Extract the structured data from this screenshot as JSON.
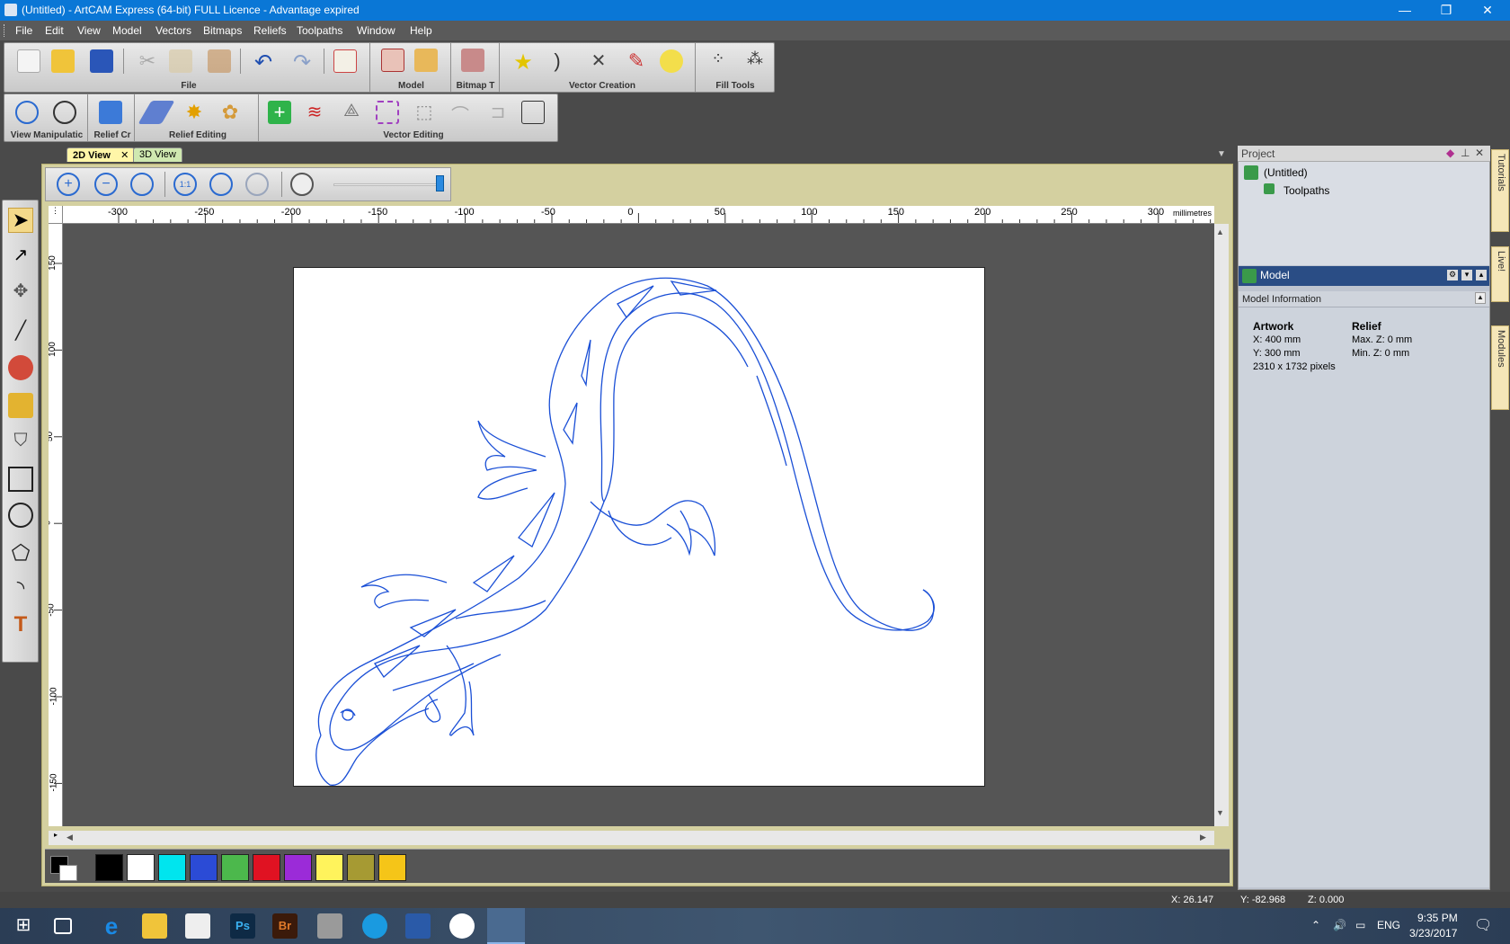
{
  "window": {
    "title": "(Untitled) - ArtCAM Express (64-bit) FULL Licence - Advantage expired",
    "minimize": "—",
    "restore": "❐",
    "close": "✕"
  },
  "menu": [
    "File",
    "Edit",
    "View",
    "Model",
    "Vectors",
    "Bitmaps",
    "Reliefs",
    "Toolpaths",
    "Window",
    "Help"
  ],
  "toolbars": {
    "file_label": "File",
    "model_label": "Model",
    "bitmap_label": "Bitmap T",
    "vector_creation_label": "Vector Creation",
    "fill_tools_label": "Fill Tools",
    "view_manipulation_label": "View Manipulatic",
    "relief_cr_label": "Relief Cr",
    "relief_editing_label": "Relief Editing",
    "vector_editing_label": "Vector Editing"
  },
  "tabs": [
    {
      "label": "2D View",
      "active": true,
      "close": "✕"
    },
    {
      "label": "3D View",
      "active": false
    }
  ],
  "ruler": {
    "h_ticks": [
      "-300",
      "-250",
      "-200",
      "-150",
      "-100",
      "-50",
      "0",
      "50",
      "100",
      "150",
      "200",
      "250",
      "300"
    ],
    "unit": "millimetres",
    "v_ticks": [
      "150",
      "100",
      "50",
      "0",
      "-50",
      "-100",
      "-150"
    ]
  },
  "palette": {
    "colors": [
      "#000000",
      "#ffffff",
      "#00e5ee",
      "#2b4bd6",
      "#4cb84c",
      "#e01222",
      "#9b2bd8",
      "#fff35c",
      "#a69a33",
      "#f5c518"
    ]
  },
  "project": {
    "title": "Project",
    "root": "(Untitled)",
    "child": "Toolpaths"
  },
  "model": {
    "title": "Model",
    "info_title": "Model Information",
    "artwork_heading": "Artwork",
    "artwork_x": "X: 400 mm",
    "artwork_y": "Y: 300 mm",
    "artwork_pixels": "2310 x 1732 pixels",
    "relief_heading": "Relief",
    "relief_max": "Max. Z: 0 mm",
    "relief_min": "Min. Z: 0 mm"
  },
  "side_tabs": [
    "Tutorials",
    "Live!",
    "Modules"
  ],
  "status": {
    "x": "X: 26.147",
    "y": "Y: -82.968",
    "z": "Z: 0.000"
  },
  "taskbar": {
    "lang": "ENG",
    "time": "9:35 PM",
    "date": "3/23/2017",
    "ps": "Ps",
    "br": "Br"
  },
  "colors": {
    "title_bar": "#0a77d6",
    "vector_line": "#1a4fd6",
    "model_header": "#2a4d85"
  }
}
